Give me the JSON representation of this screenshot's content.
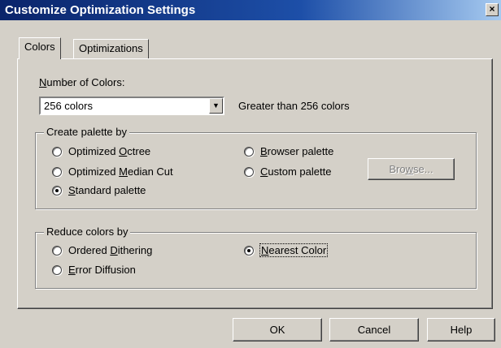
{
  "window": {
    "title": "Customize Optimization Settings",
    "close_label": "×"
  },
  "tabs": [
    {
      "label": "Colors",
      "active": true
    },
    {
      "label": "Optimizations",
      "active": false
    }
  ],
  "colors_tab": {
    "number_label_pre": "",
    "number_label_key": "N",
    "number_label_post": "umber of Colors:",
    "number_select_value": "256 colors",
    "number_select_arrow": "▼",
    "greater_text": "Greater than 256 colors",
    "palette_group": {
      "legend": "Create palette by",
      "options": [
        {
          "pre": "Optimized ",
          "key": "O",
          "post": "ctree",
          "checked": false
        },
        {
          "pre": "Optimized ",
          "key": "M",
          "post": "edian Cut",
          "checked": false
        },
        {
          "pre": "",
          "key": "S",
          "post": "tandard palette",
          "checked": true
        },
        {
          "pre": "",
          "key": "B",
          "post": "rowser palette",
          "checked": false
        },
        {
          "pre": "",
          "key": "C",
          "post": "ustom palette",
          "checked": false
        }
      ],
      "browse_pre": "Bro",
      "browse_key": "w",
      "browse_post": "se...",
      "browse_enabled": false
    },
    "reduce_group": {
      "legend": "Reduce colors by",
      "options": [
        {
          "pre": "Ordered ",
          "key": "D",
          "post": "ithering",
          "checked": false
        },
        {
          "pre": "",
          "key": "E",
          "post": "rror Diffusion",
          "checked": false
        },
        {
          "pre": "",
          "key": "N",
          "post": "earest Color",
          "checked": true
        }
      ]
    }
  },
  "buttons": {
    "ok": "OK",
    "cancel": "Cancel",
    "help": "Help"
  }
}
